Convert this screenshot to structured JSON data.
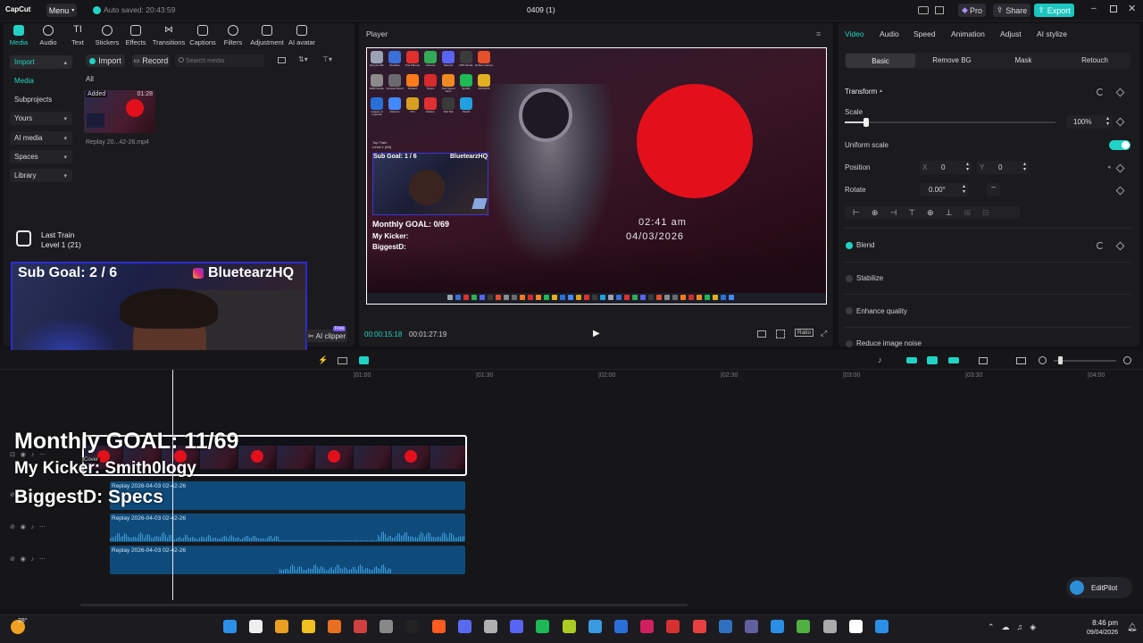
{
  "titlebar": {
    "app_name": "CapCut",
    "menu_label": "Menu",
    "autosave": "Auto saved: 20:43:59",
    "project": "0409 (1)",
    "pro": "Pro",
    "share": "Share",
    "export": "Export"
  },
  "tools": [
    "Media",
    "Audio",
    "Text",
    "Stickers",
    "Effects",
    "Transitions",
    "Captions",
    "Filters",
    "Adjustment",
    "AI avatar"
  ],
  "sidebar": {
    "import": "Import",
    "media": "Media",
    "subprojects": "Subprojects",
    "yours": "Yours",
    "ai_media": "AI media",
    "spaces": "Spaces",
    "library": "Library"
  },
  "media_toolbar": {
    "import": "Import",
    "record": "Record",
    "search_placeholder": "Search media",
    "filter_all": "All"
  },
  "media_item": {
    "badge": "Added",
    "duration": "01:28",
    "name": "Replay 20...42-26.mp4"
  },
  "player": {
    "title": "Player",
    "time_current": "00:00:15:18",
    "time_total": "00:01:27:19",
    "ratio": "Ratio"
  },
  "video_frame": {
    "sub_goal": "Sub Goal: 1 / 6",
    "channel": "BluetearzHQ",
    "monthly_goal": "Monthly GOAL: 0/69",
    "kicker": "My Kicker:",
    "biggest": "BiggestD:",
    "clock_time": "02:41 am",
    "clock_date": "04/03/2026",
    "music_title": "Top Train",
    "music_sub": "Level 1 (69)"
  },
  "desktop_icons": [
    "Recycle Bin",
    "Steelsite",
    "Proj Planner",
    "Camera",
    "Discord",
    "OBS Studio",
    "Roblox Games",
    "EMS Studio",
    "Compat Stuart",
    "ShadeX",
    "Opera",
    "Tool Speed Sens",
    "Spotify",
    "ROUNDS",
    "League of Legends",
    "Valorant",
    "NCI",
    "Roblox",
    "Dell Tab",
    "FILES"
  ],
  "overlay": {
    "music_title": "Last Train",
    "music_sub": "Level 1 (21)",
    "sub_goal": "Sub Goal: 2 / 6",
    "channel": "BluetearzHQ",
    "monthly_goal": "Monthly GOAL: 11/69",
    "kicker": "My Kicker: Smith0logy",
    "biggest": "BiggestD: Specs"
  },
  "ai_clipper": {
    "label": "AI clipper",
    "badge": "Free"
  },
  "inspector": {
    "tabs": [
      "Video",
      "Audio",
      "Speed",
      "Animation",
      "Adjust",
      "AI stylize"
    ],
    "subtabs": [
      "Basic",
      "Remove BG",
      "Mask",
      "Retouch"
    ],
    "transform": "Transform",
    "scale_label": "Scale",
    "scale_value": "100%",
    "scale_fraction": 0.1,
    "uniform_scale": "Uniform scale",
    "position": "Position",
    "pos_x_label": "X",
    "pos_x": "0",
    "pos_y_label": "Y",
    "pos_y": "0",
    "rotate": "Rotate",
    "rotate_value": "0.00°",
    "blend": "Blend",
    "stabilize": "Stabilize",
    "enhance_quality": "Enhance quality",
    "reduce_noise": "Reduce image noise",
    "accent": "#22d3c5"
  },
  "timeline": {
    "ruler": [
      "|01:00",
      "|01:30",
      "|02:00",
      "|02:30",
      "|03:00",
      "|03:30",
      "|04:00"
    ],
    "cover": "Cover",
    "clip1": "Replay 2026-04-03 02-42-26",
    "clip2": "Replay 2026-04-03 02-42-26",
    "clip3": "Replay 2026-04-03 02-42-26"
  },
  "editpilot": "EditPilot",
  "taskbar": {
    "weather": "28°",
    "time": "8:46 pm",
    "date": "09/04/2026"
  }
}
